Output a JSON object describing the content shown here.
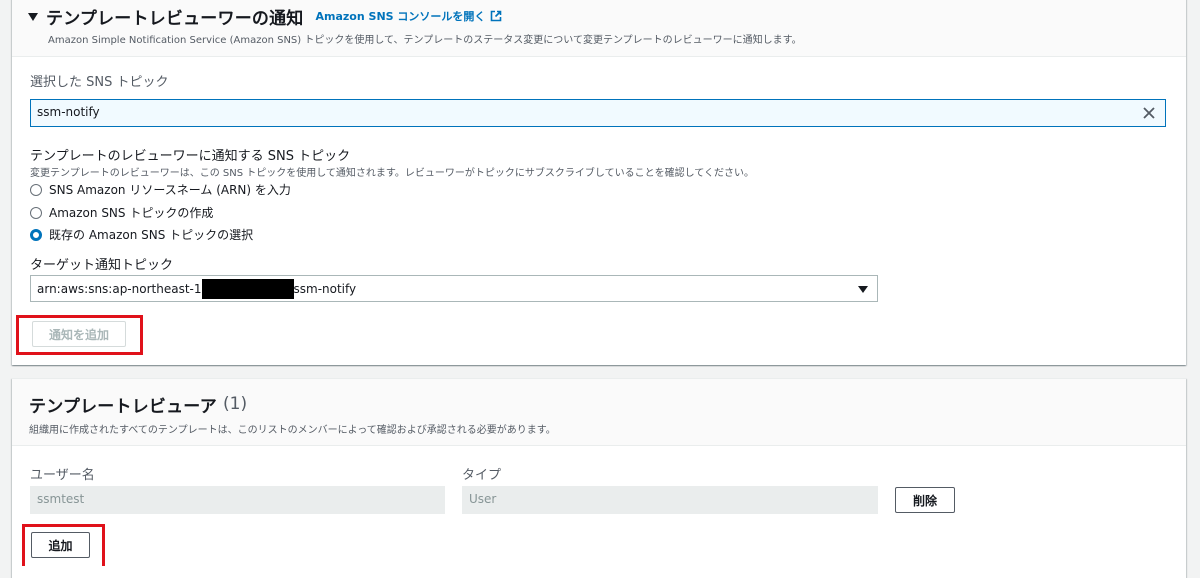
{
  "notifications": {
    "title": "テンプレートレビューワーの通知",
    "console_link": "Amazon SNS コンソールを開く",
    "description": "Amazon Simple Notification Service (Amazon SNS) トピックを使用して、テンプレートのステータス変更について変更テンプレートのレビューワーに通知します。",
    "selected_topic_label": "選択した SNS トピック",
    "selected_topic_value": "ssm-notify",
    "topic_group_label": "テンプレートのレビューワーに通知する SNS トピック",
    "topic_group_desc": "変更テンプレートのレビューワーは、この SNS トピックを使用して通知されます。レビューワーがトピックにサブスクライブしていることを確認してください。",
    "options": [
      {
        "label": "SNS Amazon リソースネーム (ARN) を入力",
        "checked": false
      },
      {
        "label": "Amazon SNS トピックの作成",
        "checked": false
      },
      {
        "label": "既存の Amazon SNS トピックの選択",
        "checked": true
      }
    ],
    "target_label": "ターゲット通知トピック",
    "target_prefix": "arn:aws:sns:ap-northeast-1",
    "target_suffix": "ssm-notify",
    "add_notification_button": "通知を追加"
  },
  "reviewers": {
    "title": "テンプレートレビューア",
    "count": "(1)",
    "description": "組織用に作成されたすべてのテンプレートは、このリストのメンバーによって確認および承認される必要があります。",
    "username_label": "ユーザー名",
    "type_label": "タイプ",
    "username_value": "ssmtest",
    "type_value": "User",
    "delete_button": "削除",
    "add_button": "追加"
  },
  "colors": {
    "accent": "#0073bb",
    "highlight": "#e0111a"
  }
}
